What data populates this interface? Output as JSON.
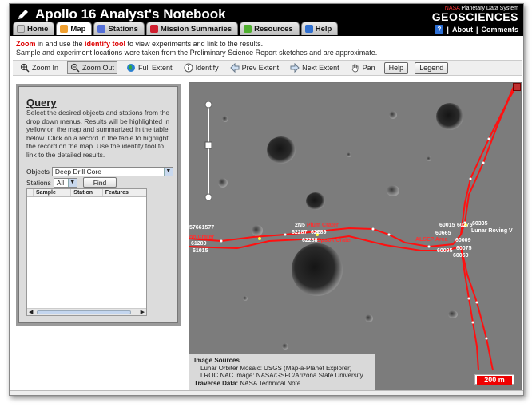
{
  "app": {
    "title": "Apollo 16 Analyst's Notebook"
  },
  "tabs": [
    {
      "label": "Home",
      "color": "#d0d0d0"
    },
    {
      "label": "Map",
      "color": "#f0a030"
    },
    {
      "label": "Stations",
      "color": "#5570d8"
    },
    {
      "label": "Mission Summaries",
      "color": "#d02030"
    },
    {
      "label": "Resources",
      "color": "#50b030"
    },
    {
      "label": "Help",
      "color": "#3070d0"
    }
  ],
  "brand": {
    "nasa": "NASA",
    "pds": "Planetary Data System",
    "name": "GEOSCIENCES",
    "help_icon": "?",
    "about": "About",
    "separator": "|",
    "comments": "Comments"
  },
  "instructions": {
    "zoom_word": "Zoom",
    "line1_a": " in and use the ",
    "identify_word": "identify tool",
    "line1_b": " to view experiments and link to the results.",
    "line2": "Sample and experiment locations were taken from the Preliminary Science Report sketches and are approximate."
  },
  "toolbar": {
    "zoom_in": "Zoom In",
    "zoom_out": "Zoom Out",
    "full_extent": "Full Extent",
    "identify": "Identify",
    "prev_extent": "Prev Extent",
    "next_extent": "Next Extent",
    "pan": "Pan",
    "help": "Help",
    "legend": "Legend"
  },
  "query": {
    "title": "Query",
    "description": "Select the desired objects and stations from the drop down menus. Results will be highlighted in yellow on the map and summarized in the table below. Click on a record in the table to highlight the record on the map. Use the identify tool to link to the detailed results.",
    "objects_label": "Objects",
    "objects_value": "Deep Drill Core",
    "stations_label": "Stations",
    "stations_value": "All",
    "find_label": "Find",
    "columns": [
      "Sample",
      "Station",
      "Features"
    ]
  },
  "map": {
    "labels": {
      "l1": "57661577",
      "l2": "61280",
      "l3": "61015",
      "l4": "2N5",
      "l5": "Plum Crater",
      "l6": "62287",
      "l7": "62289",
      "l8": "62288",
      "l9": "Spook Crater",
      "l10": "60335",
      "l11": "60015",
      "l12": "60275",
      "l13": "60665",
      "l14": "Lunar Roving V",
      "l15": "ALSEP Area",
      "l16": "60009",
      "l17": "60095",
      "l18": "60075",
      "l19": "60050",
      "l20": "on Crater"
    },
    "sources_title": "Image Sources",
    "source1": "Lunar Orbiter Mosaic: USGS (Map-a-Planet Explorer)",
    "source2": "LROC NAC image: NASA/GSFC/Arizona State University",
    "traverse_label": "Traverse Data:",
    "traverse_value": "NASA Technical Note",
    "scale": "200 m"
  }
}
